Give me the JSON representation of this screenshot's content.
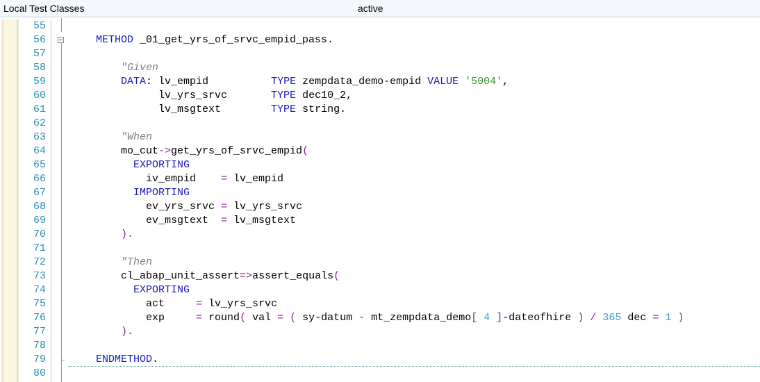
{
  "titlebar": {
    "title": "Local Test Classes",
    "status": "active"
  },
  "lines": [
    {
      "num": "55",
      "html": ""
    },
    {
      "num": "56",
      "html": "<span class=\"kw\">METHOD</span> _01_get_yrs_of_srvc_empid_pass."
    },
    {
      "num": "57",
      "html": ""
    },
    {
      "num": "58",
      "html": "    <span class=\"cm\">\"Given</span>"
    },
    {
      "num": "59",
      "html": "    <span class=\"kw\">DATA</span>: lv_empid          <span class=\"kw\">TYPE</span> zempdata_demo-empid <span class=\"kw\">VALUE</span> <span class=\"st\">'5004'</span>,"
    },
    {
      "num": "60",
      "html": "          lv_yrs_srvc       <span class=\"kw\">TYPE</span> dec10_2,"
    },
    {
      "num": "61",
      "html": "          lv_msgtext        <span class=\"kw\">TYPE</span> string."
    },
    {
      "num": "62",
      "html": ""
    },
    {
      "num": "63",
      "html": "    <span class=\"cm\">\"When</span>"
    },
    {
      "num": "64",
      "html": "    mo_cut<span class=\"op\">-&gt;</span>get_yrs_of_srvc_empid<span class=\"op\">(</span>"
    },
    {
      "num": "65",
      "html": "      <span class=\"kw\">EXPORTING</span>"
    },
    {
      "num": "66",
      "html": "        iv_empid    <span class=\"op\">=</span> lv_empid"
    },
    {
      "num": "67",
      "html": "      <span class=\"kw\">IMPORTING</span>"
    },
    {
      "num": "68",
      "html": "        ev_yrs_srvc <span class=\"op\">=</span> lv_yrs_srvc"
    },
    {
      "num": "69",
      "html": "        ev_msgtext  <span class=\"op\">=</span> lv_msgtext"
    },
    {
      "num": "70",
      "html": "    <span class=\"op\">).</span>"
    },
    {
      "num": "71",
      "html": ""
    },
    {
      "num": "72",
      "html": "    <span class=\"cm\">\"Then</span>"
    },
    {
      "num": "73",
      "html": "    cl_abap_unit_assert<span class=\"op\">=&gt;</span>assert_equals<span class=\"op\">(</span>"
    },
    {
      "num": "74",
      "html": "      <span class=\"kw\">EXPORTING</span>"
    },
    {
      "num": "75",
      "html": "        act     <span class=\"op\">=</span> lv_yrs_srvc"
    },
    {
      "num": "76",
      "html": "        exp     <span class=\"op\">=</span> round<span class=\"op\">(</span> val <span class=\"op\">=</span> <span class=\"op\">(</span> sy-datum <span class=\"op\">-</span> mt_zempdata_demo<span class=\"op\">[</span> <span class=\"nu\">4</span> <span class=\"op\">]</span>-dateofhire <span class=\"op\">)</span> <span class=\"op\">/</span> <span class=\"nu\">365</span> dec <span class=\"op\">=</span> <span class=\"nu\">1</span> <span class=\"op\">)</span>"
    },
    {
      "num": "77",
      "html": "    <span class=\"op\">).</span>"
    },
    {
      "num": "78",
      "html": ""
    },
    {
      "num": "79",
      "html": "<span class=\"kw\">ENDMETHOD</span>."
    },
    {
      "num": "80",
      "html": ""
    }
  ],
  "fold": {
    "open_line": "56",
    "close_line": "79"
  }
}
